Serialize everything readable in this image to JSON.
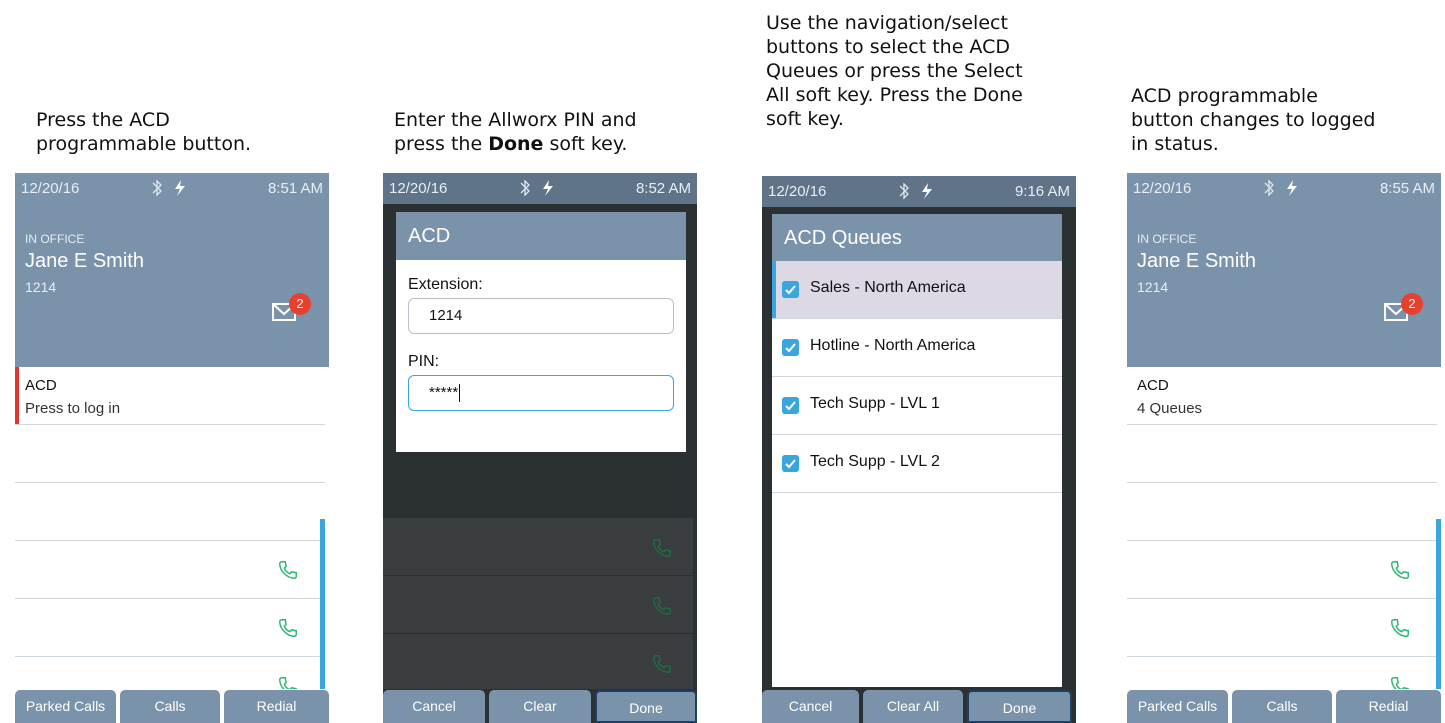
{
  "captions": {
    "step1": [
      "Press the ACD",
      "programmable button."
    ],
    "step2_line1": "Enter the Allworx PIN and",
    "step2_line2_pre": "press the ",
    "step2_line2_bold": "Done",
    "step2_line2_post": " soft key.",
    "step3": [
      "Use the navigation/select",
      "buttons to select the ACD",
      "Queues or press the Select",
      "All soft key. Press the Done",
      "soft key."
    ],
    "step4": [
      "ACD programmable",
      "button changes to logged",
      "in status."
    ]
  },
  "screens": {
    "s1": {
      "date": "12/20/16",
      "time": "8:51 AM",
      "status_label": "IN OFFICE",
      "name": "Jane E Smith",
      "ext": "1214",
      "badge": "2",
      "acd_title": "ACD",
      "acd_sub": "Press to log in",
      "softkeys": [
        "Parked Calls",
        "Calls",
        "Redial"
      ]
    },
    "s2": {
      "date": "12/20/16",
      "time": "8:52 AM",
      "dialog_title": "ACD",
      "ext_label": "Extension:",
      "ext_value": "1214",
      "pin_label": "PIN:",
      "pin_value": "*****",
      "softkeys": [
        "Cancel",
        "Clear",
        "Done"
      ]
    },
    "s3": {
      "date": "12/20/16",
      "time": "9:16 AM",
      "dialog_title": "ACD Queues",
      "queues": [
        "Sales - North America",
        "Hotline - North America",
        "Tech Supp - LVL 1",
        "Tech Supp - LVL 2"
      ],
      "softkeys": [
        "Cancel",
        "Clear All",
        "Done"
      ]
    },
    "s4": {
      "date": "12/20/16",
      "time": "8:55 AM",
      "status_label": "IN OFFICE",
      "name": "Jane E Smith",
      "ext": "1214",
      "badge": "2",
      "acd_title": "ACD",
      "acd_sub": "4 Queues",
      "softkeys": [
        "Parked Calls",
        "Calls",
        "Redial"
      ]
    }
  },
  "colors": {
    "header": "#7a93aa",
    "accent_blue": "#3aa6e0",
    "alert_red": "#e0362b",
    "call_green": "#2bb673"
  }
}
